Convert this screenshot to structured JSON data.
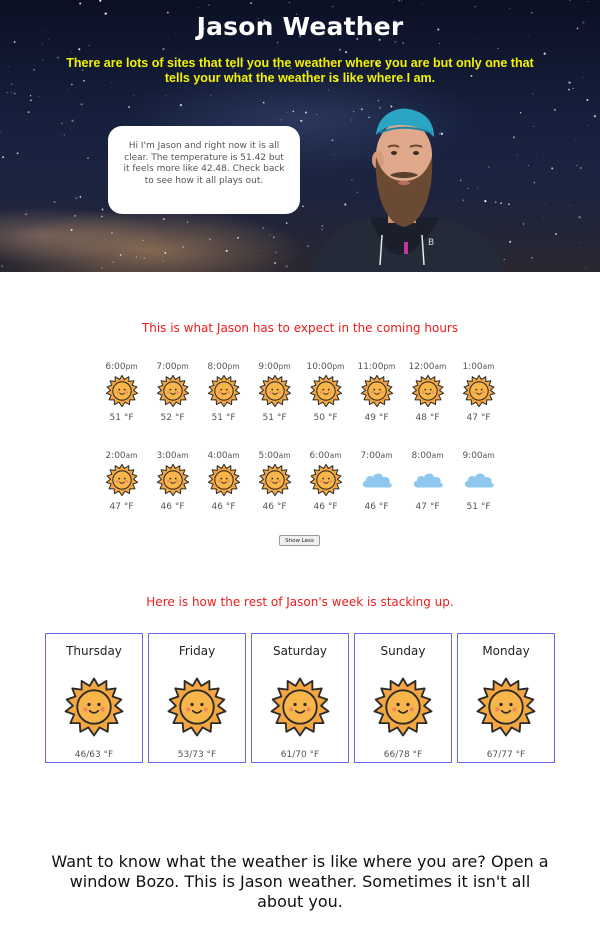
{
  "header": {
    "title": "Jason Weather",
    "tagline": "There are lots of sites that tell you the weather where you are but only one that tells your what the weather is like where I am.",
    "bubble_text": "Hi I'm Jason and right now it is all clear. The temperature is 51.42 but it feels more like 42.48. Check back to see how it all plays out."
  },
  "hourly": {
    "heading": "This is what Jason has to expect in the coming hours",
    "rows": [
      [
        {
          "time": "6:00",
          "ampm": "pm",
          "temp": "51 °F",
          "icon": "sun-icon"
        },
        {
          "time": "7:00",
          "ampm": "pm",
          "temp": "52 °F",
          "icon": "sun-icon"
        },
        {
          "time": "8:00",
          "ampm": "pm",
          "temp": "51 °F",
          "icon": "sun-icon"
        },
        {
          "time": "9:00",
          "ampm": "pm",
          "temp": "51 °F",
          "icon": "sun-icon"
        },
        {
          "time": "10:00",
          "ampm": "pm",
          "temp": "50 °F",
          "icon": "sun-icon"
        },
        {
          "time": "11:00",
          "ampm": "pm",
          "temp": "49 °F",
          "icon": "sun-icon"
        },
        {
          "time": "12:00",
          "ampm": "am",
          "temp": "48 °F",
          "icon": "sun-icon"
        },
        {
          "time": "1:00",
          "ampm": "am",
          "temp": "47 °F",
          "icon": "sun-icon"
        }
      ],
      [
        {
          "time": "2:00",
          "ampm": "am",
          "temp": "47 °F",
          "icon": "sun-icon"
        },
        {
          "time": "3:00",
          "ampm": "am",
          "temp": "46 °F",
          "icon": "sun-icon"
        },
        {
          "time": "4:00",
          "ampm": "am",
          "temp": "46 °F",
          "icon": "sun-icon"
        },
        {
          "time": "5:00",
          "ampm": "am",
          "temp": "46 °F",
          "icon": "sun-icon"
        },
        {
          "time": "6:00",
          "ampm": "am",
          "temp": "46 °F",
          "icon": "sun-icon"
        },
        {
          "time": "7:00",
          "ampm": "am",
          "temp": "46 °F",
          "icon": "cloud-icon"
        },
        {
          "time": "8:00",
          "ampm": "am",
          "temp": "47 °F",
          "icon": "cloud-icon"
        },
        {
          "time": "9:00",
          "ampm": "am",
          "temp": "51 °F",
          "icon": "cloud-icon"
        }
      ]
    ],
    "show_less_label": "Show Less"
  },
  "daily": {
    "heading": "Here is how the rest of Jason's week is stacking up.",
    "days": [
      {
        "name": "Thursday",
        "temp": "46/63 °F",
        "icon": "sun-icon"
      },
      {
        "name": "Friday",
        "temp": "53/73 °F",
        "icon": "sun-icon"
      },
      {
        "name": "Saturday",
        "temp": "61/70 °F",
        "icon": "sun-icon"
      },
      {
        "name": "Sunday",
        "temp": "66/78 °F",
        "icon": "sun-icon"
      },
      {
        "name": "Monday",
        "temp": "67/77 °F",
        "icon": "sun-icon"
      }
    ]
  },
  "footer": {
    "text": "Want to know what the weather is like where you are? Open a window Bozo. This is Jason weather. Sometimes it isn't all about you."
  },
  "colors": {
    "heading_red": "#ee1c1c",
    "tagline_yellow": "#f5f200",
    "card_border": "#6a6ae8",
    "sun_orange": "#f4a640",
    "cloud_blue": "#8fc7ef"
  }
}
